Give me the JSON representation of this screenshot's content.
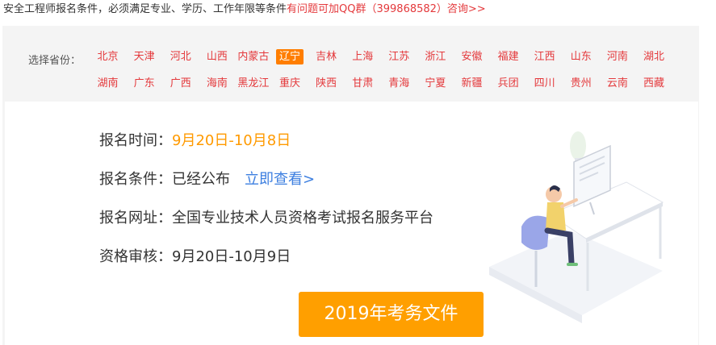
{
  "notice": {
    "text": "安全工程师报名条件，必须满足专业、学历、工作年限等条件",
    "link": "有问题可加QQ群（399868582）咨询>>"
  },
  "provinces": {
    "label": "选择省份：",
    "row1": [
      "北京",
      "天津",
      "河北",
      "山西",
      "内蒙古",
      "辽宁",
      "吉林",
      "上海",
      "江苏",
      "浙江",
      "安徽",
      "福建",
      "江西",
      "山东",
      "河南",
      "湖北"
    ],
    "row2": [
      "湖南",
      "广东",
      "广西",
      "海南",
      "黑龙江",
      "重庆",
      "陕西",
      "甘肃",
      "青海",
      "宁夏",
      "新疆",
      "兵团",
      "四川",
      "贵州",
      "云南",
      "西藏"
    ],
    "active": "辽宁"
  },
  "info": {
    "time_label": "报名时间：",
    "time_value": "9月20日-10月8日",
    "cond_label": "报名条件：",
    "cond_value": "已经公布",
    "cond_link": "立即查看>",
    "site_label": "报名网址：",
    "site_value": "全国专业技术人员资格考试报名服务平台",
    "review_label": "资格审核：",
    "review_value": "9月20日-10月9日"
  },
  "cta": {
    "label": "2019年考务文件"
  },
  "colors": {
    "accent": "#ff9f00",
    "link_red": "#e4393c",
    "link_blue": "#3d7fe0"
  }
}
